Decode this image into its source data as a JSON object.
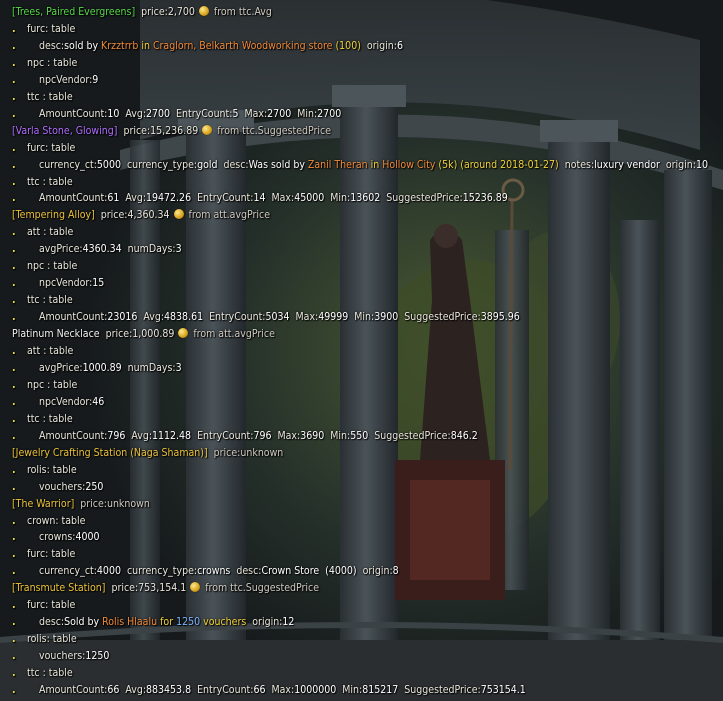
{
  "rows": [
    {
      "type": "top",
      "parts": [
        {
          "t": "[Trees, Paired Evergreens]",
          "c": "lbl-green"
        },
        {
          "t": "  price:2,700 ",
          "c": "price"
        },
        {
          "coin": true
        },
        {
          "t": " from ttc.Avg",
          "c": "src"
        }
      ]
    },
    {
      "type": "k0",
      "parts": [
        {
          "t": "furc: table",
          "c": "k"
        }
      ]
    },
    {
      "type": "k1",
      "parts": [
        {
          "t": "desc:",
          "c": "k"
        },
        {
          "t": "sold by ",
          "c": "v"
        },
        {
          "t": "Krzztrrb",
          "c": "name-orange"
        },
        {
          "t": " in ",
          "c": "name-yellow"
        },
        {
          "t": "Craglorn, Belkarth Woodworking store",
          "c": "name-orange"
        },
        {
          "t": " (100)",
          "c": "name-yellow"
        },
        {
          "t": "  origin:",
          "c": "k"
        },
        {
          "t": "6",
          "c": "v"
        }
      ]
    },
    {
      "type": "k0",
      "parts": [
        {
          "t": "npc : table",
          "c": "k"
        }
      ]
    },
    {
      "type": "k1",
      "parts": [
        {
          "t": "npcVendor:",
          "c": "k"
        },
        {
          "t": "9",
          "c": "v"
        }
      ]
    },
    {
      "type": "k0",
      "parts": [
        {
          "t": "ttc : table",
          "c": "k"
        }
      ]
    },
    {
      "type": "k1",
      "parts": [
        {
          "t": "AmountCount:",
          "c": "k"
        },
        {
          "t": "10",
          "c": "v"
        },
        {
          "t": "  Avg:",
          "c": "k"
        },
        {
          "t": "2700",
          "c": "v"
        },
        {
          "t": "  EntryCount:",
          "c": "k"
        },
        {
          "t": "5",
          "c": "v"
        },
        {
          "t": "  Max:",
          "c": "k"
        },
        {
          "t": "2700",
          "c": "v"
        },
        {
          "t": "  Min:",
          "c": "k"
        },
        {
          "t": "2700",
          "c": "v"
        }
      ]
    },
    {
      "type": "top",
      "parts": [
        {
          "t": "[Varla Stone, Glowing]",
          "c": "lbl-purple"
        },
        {
          "t": "  price:15,236.89 ",
          "c": "price"
        },
        {
          "coin": true
        },
        {
          "t": " from ttc.SuggestedPrice",
          "c": "src"
        }
      ]
    },
    {
      "type": "k0",
      "parts": [
        {
          "t": "furc: table",
          "c": "k"
        }
      ]
    },
    {
      "type": "k1",
      "parts": [
        {
          "t": "currency_ct:",
          "c": "k"
        },
        {
          "t": "5000",
          "c": "v"
        },
        {
          "t": "  currency_type:",
          "c": "k"
        },
        {
          "t": "gold",
          "c": "v"
        },
        {
          "t": "  desc:",
          "c": "k"
        },
        {
          "t": "Was sold by ",
          "c": "v"
        },
        {
          "t": "Zanil Theran",
          "c": "name-orange"
        },
        {
          "t": " in ",
          "c": "name-yellow"
        },
        {
          "t": "Hollow City",
          "c": "name-orange"
        },
        {
          "t": " (5k) (around 2018-01-27)",
          "c": "name-yellow"
        },
        {
          "t": "  notes:",
          "c": "k"
        },
        {
          "t": "luxury vendor",
          "c": "v"
        },
        {
          "t": "  origin:",
          "c": "k"
        },
        {
          "t": "10",
          "c": "v"
        }
      ]
    },
    {
      "type": "k0",
      "parts": [
        {
          "t": "ttc : table",
          "c": "k"
        }
      ]
    },
    {
      "type": "k1",
      "parts": [
        {
          "t": "AmountCount:",
          "c": "k"
        },
        {
          "t": "61",
          "c": "v"
        },
        {
          "t": "  Avg:",
          "c": "k"
        },
        {
          "t": "19472.26",
          "c": "v"
        },
        {
          "t": "  EntryCount:",
          "c": "k"
        },
        {
          "t": "14",
          "c": "v"
        },
        {
          "t": "  Max:",
          "c": "k"
        },
        {
          "t": "45000",
          "c": "v"
        },
        {
          "t": "  Min:",
          "c": "k"
        },
        {
          "t": "13602",
          "c": "v"
        },
        {
          "t": "  SuggestedPrice:",
          "c": "k"
        },
        {
          "t": "15236.89",
          "c": "v"
        }
      ]
    },
    {
      "type": "top",
      "parts": [
        {
          "t": "[Tempering Alloy]",
          "c": "lbl-gold"
        },
        {
          "t": "  price:4,360.34 ",
          "c": "price"
        },
        {
          "coin": true
        },
        {
          "t": " from att.avgPrice",
          "c": "src"
        }
      ]
    },
    {
      "type": "k0",
      "parts": [
        {
          "t": "att : table",
          "c": "k"
        }
      ]
    },
    {
      "type": "k1",
      "parts": [
        {
          "t": "avgPrice:",
          "c": "k"
        },
        {
          "t": "4360.34",
          "c": "v"
        },
        {
          "t": "  numDays:",
          "c": "k"
        },
        {
          "t": "3",
          "c": "v"
        }
      ]
    },
    {
      "type": "k0",
      "parts": [
        {
          "t": "npc : table",
          "c": "k"
        }
      ]
    },
    {
      "type": "k1",
      "parts": [
        {
          "t": "npcVendor:",
          "c": "k"
        },
        {
          "t": "15",
          "c": "v"
        }
      ]
    },
    {
      "type": "k0",
      "parts": [
        {
          "t": "ttc : table",
          "c": "k"
        }
      ]
    },
    {
      "type": "k1",
      "parts": [
        {
          "t": "AmountCount:",
          "c": "k"
        },
        {
          "t": "23016",
          "c": "v"
        },
        {
          "t": "  Avg:",
          "c": "k"
        },
        {
          "t": "4838.61",
          "c": "v"
        },
        {
          "t": "  EntryCount:",
          "c": "k"
        },
        {
          "t": "5034",
          "c": "v"
        },
        {
          "t": "  Max:",
          "c": "k"
        },
        {
          "t": "49999",
          "c": "v"
        },
        {
          "t": "  Min:",
          "c": "k"
        },
        {
          "t": "3900",
          "c": "v"
        },
        {
          "t": "  SuggestedPrice:",
          "c": "k"
        },
        {
          "t": "3895.96",
          "c": "v"
        }
      ]
    },
    {
      "type": "top",
      "parts": [
        {
          "t": "Platinum Necklace",
          "c": "lbl-white"
        },
        {
          "t": "  price:1,000.89 ",
          "c": "price"
        },
        {
          "coin": true
        },
        {
          "t": " from att.avgPrice",
          "c": "src"
        }
      ]
    },
    {
      "type": "k0",
      "parts": [
        {
          "t": "att : table",
          "c": "k"
        }
      ]
    },
    {
      "type": "k1",
      "parts": [
        {
          "t": "avgPrice:",
          "c": "k"
        },
        {
          "t": "1000.89",
          "c": "v"
        },
        {
          "t": "  numDays:",
          "c": "k"
        },
        {
          "t": "3",
          "c": "v"
        }
      ]
    },
    {
      "type": "k0",
      "parts": [
        {
          "t": "npc : table",
          "c": "k"
        }
      ]
    },
    {
      "type": "k1",
      "parts": [
        {
          "t": "npcVendor:",
          "c": "k"
        },
        {
          "t": "46",
          "c": "v"
        }
      ]
    },
    {
      "type": "k0",
      "parts": [
        {
          "t": "ttc : table",
          "c": "k"
        }
      ]
    },
    {
      "type": "k1",
      "parts": [
        {
          "t": "AmountCount:",
          "c": "k"
        },
        {
          "t": "796",
          "c": "v"
        },
        {
          "t": "  Avg:",
          "c": "k"
        },
        {
          "t": "1112.48",
          "c": "v"
        },
        {
          "t": "  EntryCount:",
          "c": "k"
        },
        {
          "t": "796",
          "c": "v"
        },
        {
          "t": "  Max:",
          "c": "k"
        },
        {
          "t": "3690",
          "c": "v"
        },
        {
          "t": "  Min:",
          "c": "k"
        },
        {
          "t": "550",
          "c": "v"
        },
        {
          "t": "  SuggestedPrice:",
          "c": "k"
        },
        {
          "t": "846.2",
          "c": "v"
        }
      ]
    },
    {
      "type": "top",
      "parts": [
        {
          "t": "[Jewelry Crafting Station (Naga Shaman)]",
          "c": "lbl-gold"
        },
        {
          "t": "  price:unknown",
          "c": "src"
        }
      ]
    },
    {
      "type": "k0",
      "parts": [
        {
          "t": "rolis: table",
          "c": "k"
        }
      ]
    },
    {
      "type": "k1",
      "parts": [
        {
          "t": "vouchers:",
          "c": "k"
        },
        {
          "t": "250",
          "c": "v"
        }
      ]
    },
    {
      "type": "top",
      "parts": [
        {
          "t": "[The Warrior]",
          "c": "lbl-gold"
        },
        {
          "t": "  price:unknown",
          "c": "src"
        }
      ]
    },
    {
      "type": "k0",
      "parts": [
        {
          "t": "crown: table",
          "c": "k"
        }
      ]
    },
    {
      "type": "k1",
      "parts": [
        {
          "t": "crowns:",
          "c": "k"
        },
        {
          "t": "4000",
          "c": "v"
        }
      ]
    },
    {
      "type": "k0",
      "parts": [
        {
          "t": "furc: table",
          "c": "k"
        }
      ]
    },
    {
      "type": "k1",
      "parts": [
        {
          "t": "currency_ct:",
          "c": "k"
        },
        {
          "t": "4000",
          "c": "v"
        },
        {
          "t": "  currency_type:",
          "c": "k"
        },
        {
          "t": "crowns",
          "c": "v"
        },
        {
          "t": "  desc:",
          "c": "k"
        },
        {
          "t": "Crown Store  (4000)",
          "c": "v"
        },
        {
          "t": "  origin:",
          "c": "k"
        },
        {
          "t": "8",
          "c": "v"
        }
      ]
    },
    {
      "type": "top",
      "parts": [
        {
          "t": "[Transmute Station]",
          "c": "lbl-gold"
        },
        {
          "t": "  price:753,154.1 ",
          "c": "price"
        },
        {
          "coin": true
        },
        {
          "t": " from ttc.SuggestedPrice",
          "c": "src"
        }
      ]
    },
    {
      "type": "k0",
      "parts": [
        {
          "t": "furc: table",
          "c": "k"
        }
      ]
    },
    {
      "type": "k1",
      "parts": [
        {
          "t": "desc:",
          "c": "k"
        },
        {
          "t": "Sold by ",
          "c": "v"
        },
        {
          "t": "Rolis Hlaalu",
          "c": "name-orange"
        },
        {
          "t": " for ",
          "c": "name-yellow"
        },
        {
          "t": "1250",
          "c": "name-blue"
        },
        {
          "t": " vouchers",
          "c": "name-yellow"
        },
        {
          "t": "  origin:",
          "c": "k"
        },
        {
          "t": "12",
          "c": "v"
        }
      ]
    },
    {
      "type": "k0",
      "parts": [
        {
          "t": "rolis: table",
          "c": "k"
        }
      ]
    },
    {
      "type": "k1",
      "parts": [
        {
          "t": "vouchers:",
          "c": "k"
        },
        {
          "t": "1250",
          "c": "v"
        }
      ]
    },
    {
      "type": "k0",
      "parts": [
        {
          "t": "ttc : table",
          "c": "k"
        }
      ]
    },
    {
      "type": "k1",
      "parts": [
        {
          "t": "AmountCount:",
          "c": "k"
        },
        {
          "t": "66",
          "c": "v"
        },
        {
          "t": "  Avg:",
          "c": "k"
        },
        {
          "t": "883453.8",
          "c": "v"
        },
        {
          "t": "  EntryCount:",
          "c": "k"
        },
        {
          "t": "66",
          "c": "v"
        },
        {
          "t": "  Max:",
          "c": "k"
        },
        {
          "t": "1000000",
          "c": "v"
        },
        {
          "t": "  Min:",
          "c": "k"
        },
        {
          "t": "815217",
          "c": "v"
        },
        {
          "t": "  SuggestedPrice:",
          "c": "k"
        },
        {
          "t": "753154.1",
          "c": "v"
        }
      ]
    }
  ],
  "bullet": ".",
  "icons": {
    "coin": "gold-coin-icon"
  }
}
